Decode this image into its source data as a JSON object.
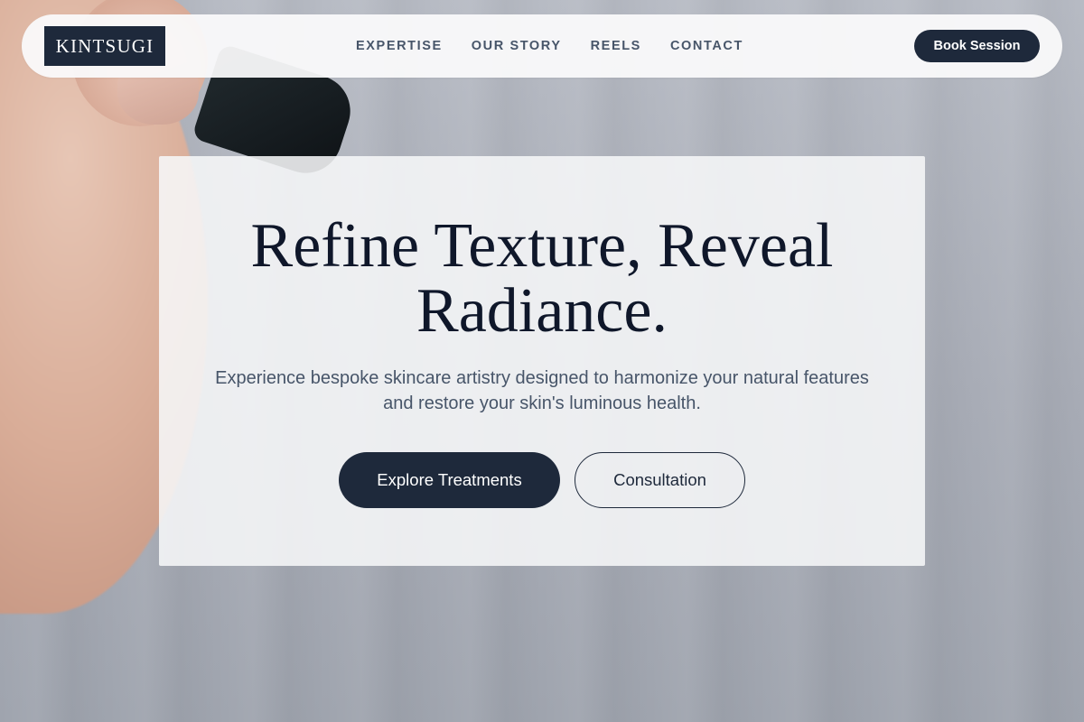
{
  "brand": {
    "logo_text": "KINTSUGI"
  },
  "nav": {
    "links": [
      {
        "label": "EXPERTISE"
      },
      {
        "label": "OUR STORY"
      },
      {
        "label": "REELS"
      },
      {
        "label": "CONTACT"
      }
    ],
    "cta_label": "Book Session"
  },
  "hero": {
    "title": "Refine Texture, Reveal Radiance.",
    "subtitle": "Experience bespoke skincare artistry designed to harmonize your natural features and restore your skin's luminous health.",
    "primary_button": "Explore Treatments",
    "secondary_button": "Consultation"
  },
  "colors": {
    "primary": "#1e293b",
    "heading": "#0f172a",
    "muted_text": "#475569",
    "nav_background": "#fafafb",
    "card_background": "#f6f7f8"
  }
}
